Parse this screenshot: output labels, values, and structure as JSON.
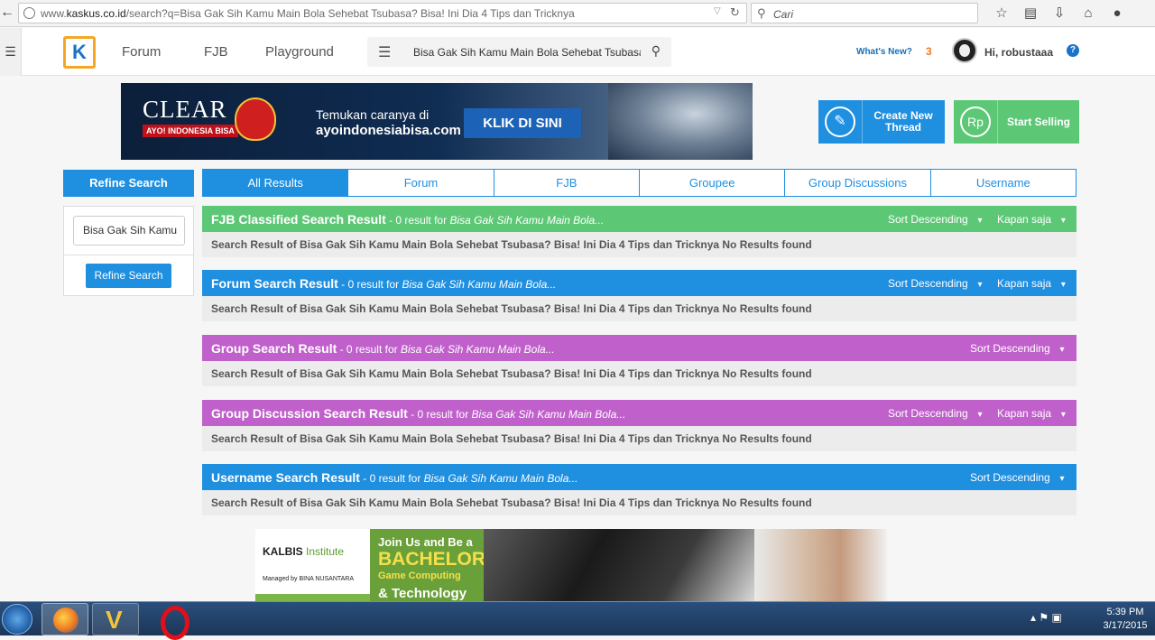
{
  "browser": {
    "url_prefix": "www.",
    "url_domain": "kaskus.co.id",
    "url_path": "/search?q=Bisa Gak Sih Kamu Main Bola Sehebat Tsubasa? Bisa! Ini Dia 4 Tips dan Tricknya",
    "search_placeholder": "Cari"
  },
  "header": {
    "logo_letter": "K",
    "nav": [
      "Forum",
      "FJB",
      "Playground"
    ],
    "search_query": "Bisa Gak Sih Kamu Main Bola Sehebat Tsubasa",
    "whats_new": "What's New?",
    "notif_count": "3",
    "greeting": "Hi, robustaaa",
    "help": "?"
  },
  "banner": {
    "brand": "CLEAR",
    "sub": "AYO! INDONESIA BISA",
    "tagline_1": "Temukan caranya di",
    "tagline_2": "ayoindonesiabisa.com",
    "cta": "KLIK DI SINI"
  },
  "actions": {
    "create_thread": "Create New Thread",
    "start_selling": "Start Selling",
    "sell_icon": "Rp"
  },
  "refine": {
    "heading": "Refine Search",
    "input_value": "Bisa Gak Sih Kamu",
    "button": "Refine Search"
  },
  "tabs": [
    "All Results",
    "Forum",
    "FJB",
    "Groupee",
    "Group Discussions",
    "Username"
  ],
  "results": [
    {
      "title": "FJB Classified Search Result",
      "count": " - 0 result for ",
      "query": "Bisa Gak Sih Kamu Main Bola...",
      "sort": "Sort Descending",
      "time": "Kapan saja",
      "message": "Search Result of Bisa Gak Sih Kamu Main Bola Sehebat Tsubasa? Bisa! Ini Dia 4 Tips dan Tricknya No Results found",
      "color": "#5cc876"
    },
    {
      "title": "Forum Search Result",
      "count": " - 0 result for ",
      "query": "Bisa Gak Sih Kamu Main Bola...",
      "sort": "Sort Descending",
      "time": "Kapan saja",
      "message": "Search Result of Bisa Gak Sih Kamu Main Bola Sehebat Tsubasa? Bisa! Ini Dia 4 Tips dan Tricknya No Results found",
      "color": "#1f8fe0"
    },
    {
      "title": "Group Search Result",
      "count": " - 0 result for ",
      "query": "Bisa Gak Sih Kamu Main Bola...",
      "sort": "Sort Descending",
      "time": "",
      "message": "Search Result of Bisa Gak Sih Kamu Main Bola Sehebat Tsubasa? Bisa! Ini Dia 4 Tips dan Tricknya No Results found",
      "color": "#c061cb"
    },
    {
      "title": "Group Discussion Search Result",
      "count": " - 0 result for ",
      "query": "Bisa Gak Sih Kamu Main Bola...",
      "sort": "Sort Descending",
      "time": "Kapan saja",
      "message": "Search Result of Bisa Gak Sih Kamu Main Bola Sehebat Tsubasa? Bisa! Ini Dia 4 Tips dan Tricknya No Results found",
      "color": "#c061cb"
    },
    {
      "title": "Username Search Result",
      "count": " - 0 result for ",
      "query": "Bisa Gak Sih Kamu Main Bola...",
      "sort": "Sort Descending",
      "time": "",
      "message": "Search Result of Bisa Gak Sih Kamu Main Bola Sehebat Tsubasa? Bisa! Ini Dia 4 Tips dan Tricknya No Results found",
      "color": "#1f8fe0"
    }
  ],
  "ad2": {
    "brand": "KALBIS",
    "brand_suffix": "Institute",
    "managed_by": "Managed by BINA NUSANTARA",
    "line1": "Join Us and Be a",
    "line2": "BACHELOR",
    "line3": "Game Computing",
    "line4": "& Technology"
  },
  "taskbar": {
    "time": "5:39 PM",
    "date": "3/17/2015"
  }
}
